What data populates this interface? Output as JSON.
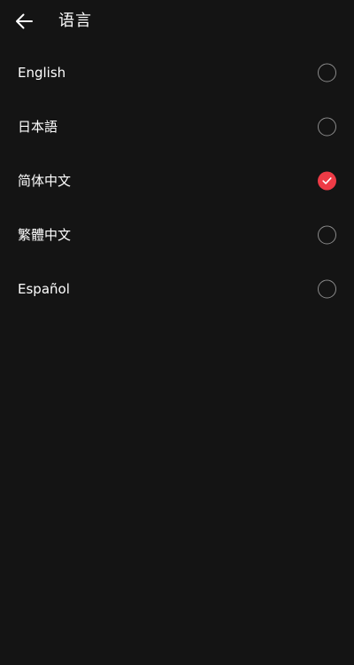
{
  "header": {
    "title": "语言",
    "back_icon": "arrow-left-icon"
  },
  "colors": {
    "background": "#141414",
    "accent": "#ee3b46",
    "radio_border": "#8a8a8a",
    "text": "#ffffff"
  },
  "languages": [
    {
      "label": "English",
      "selected": false
    },
    {
      "label": "日本語",
      "selected": false
    },
    {
      "label": "简体中文",
      "selected": true
    },
    {
      "label": "繁體中文",
      "selected": false
    },
    {
      "label": "Español",
      "selected": false
    }
  ]
}
